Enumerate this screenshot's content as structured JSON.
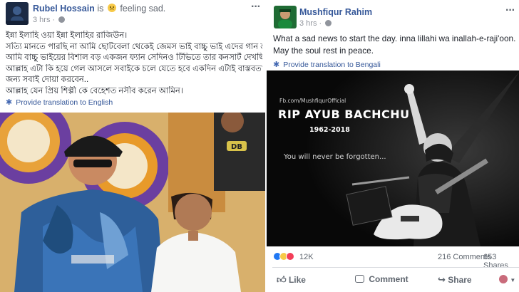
{
  "left_post": {
    "author": "Rubel Hossain",
    "status_prefix": "is",
    "feeling_icon": "sad-face-emoji",
    "feeling_text": "feeling sad.",
    "time": "3 hrs",
    "more_icon": "more-dots-icon",
    "lines": [
      "ইন্না ইলাহি ওয়া ইন্না ইলাহির রাজিউন।",
      "সত্যি মানতে পারছি না আমি ছোটবেলা থেকেই জেমস ভাই বাচ্চু ভাই এদের গান শুনি.",
      "আমি বাচ্চু ভাইয়ের বিশাল বড় একজন ফ্যান সেদিনও টিভিতে তার কনসার্ট দেখছিলাম.",
      "আল্লাহ এটা কি হয়ে গেল আসলে সবাইকে চলে যেতে হবে একদিন এটাই বাস্তবতা তার",
      "জন্য সবাই দোয়া করবেন..",
      "আল্লাহ যেন প্রিয় শিল্পী কে বেহেশত নসীব করেন আমিন।"
    ],
    "translate_label": "Provide translation to English",
    "photo_label": "DB"
  },
  "right_post": {
    "author": "Mushfiqur Rahim",
    "time": "3 hrs",
    "more_icon": "more-dots-icon",
    "text_lines": [
      "What a sad news to start the day. inna lillahi wa inallah-e-raji'oon.",
      "May the soul rest in peace."
    ],
    "translate_label": "Provide translation to Bengali",
    "image": {
      "credit": "Fb.com/MushfiqurOfficial",
      "title": "RIP AYUB BACHCHU",
      "years": "1962-2018",
      "tagline": "You will never be forgotten..."
    },
    "reactions": {
      "icons": [
        "like-reaction-icon",
        "sad-reaction-icon",
        "love-reaction-icon"
      ],
      "count": "12K",
      "comments": "216 Comments",
      "shares": "653 Shares"
    },
    "actions": {
      "like": "Like",
      "comment": "Comment",
      "share": "Share"
    },
    "colors": {
      "link": "#365899",
      "like_blue": "#2078f4",
      "sad_yellow": "#f7c948",
      "love_red": "#f33e58"
    }
  }
}
